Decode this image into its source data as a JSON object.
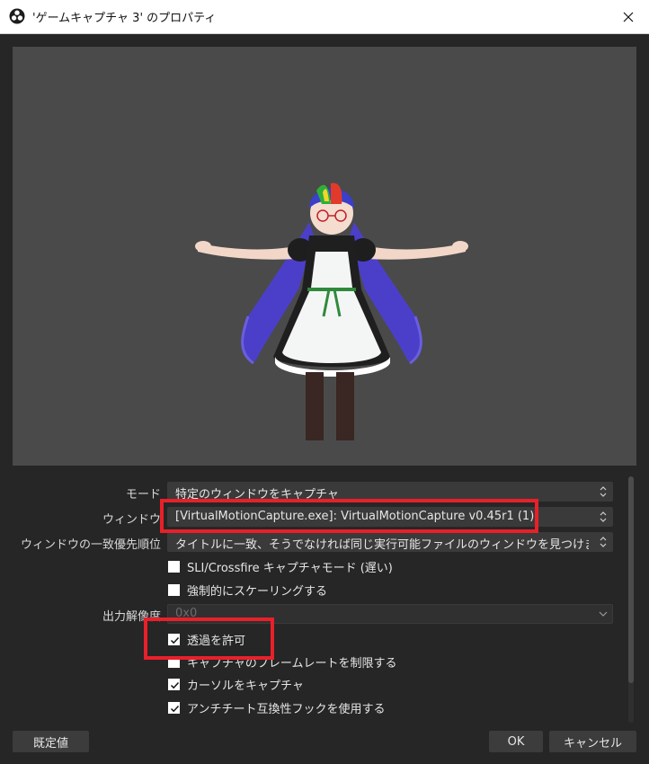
{
  "window": {
    "title": "'ゲームキャプチャ 3' のプロパティ"
  },
  "preview": {
    "background": "#4a4a4a"
  },
  "properties": {
    "mode": {
      "label": "モード",
      "value": "特定のウィンドウをキャプチャ"
    },
    "window": {
      "label": "ウィンドウ",
      "value": "[VirtualMotionCapture.exe]: VirtualMotionCapture v0.45r1 (1)"
    },
    "priority": {
      "label": "ウィンドウの一致優先順位",
      "value": "タイトルに一致、そうでなければ同じ実行可能ファイルのウィンドウを見つけます"
    },
    "sli": {
      "label": "SLI/Crossfire キャプチャモード (遅い)",
      "checked": false
    },
    "force_scaling": {
      "label": "強制的にスケーリングする",
      "checked": false
    },
    "output_resolution": {
      "label": "出力解像度",
      "value": "0x0"
    },
    "allow_transparency": {
      "label": "透過を許可",
      "checked": true
    },
    "limit_framerate": {
      "label": "キャプチャのフレームレートを制限する",
      "checked": false
    },
    "capture_cursor": {
      "label": "カーソルをキャプチャ",
      "checked": true
    },
    "anticheat_hook": {
      "label": "アンチチート互換性フックを使用する",
      "checked": true
    }
  },
  "buttons": {
    "defaults": "既定値",
    "ok": "OK",
    "cancel": "キャンセル"
  },
  "colors": {
    "highlight": "#e8202a",
    "panel": "#262626"
  }
}
